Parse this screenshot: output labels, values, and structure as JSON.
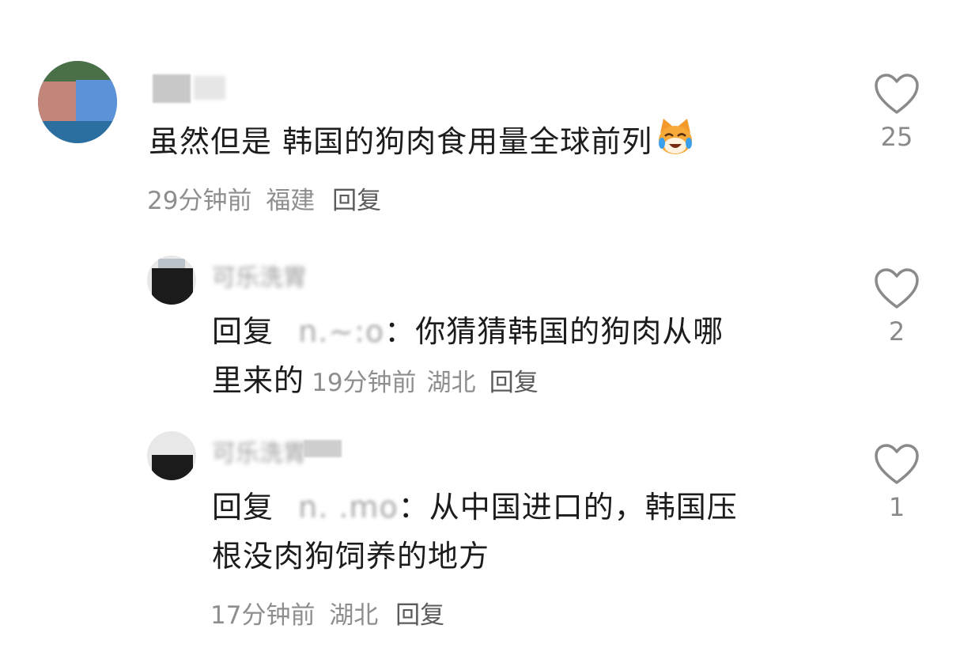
{
  "comments": [
    {
      "username": "██ ███",
      "text": "虽然但是 韩国的狗肉食用量全球前列",
      "emoji": "cat-laughing-crying-emoji",
      "time": "29分钟前",
      "location": "福建",
      "reply_label": "回复",
      "likes": "25"
    }
  ],
  "replies": [
    {
      "username": "可乐洗胃",
      "prefix": "回复",
      "mention": "n.~:o",
      "colon": "：",
      "text_line1": "你猜猜韩国的狗肉从哪",
      "text_line2": "里来的",
      "time": "19分钟前",
      "location": "湖北",
      "reply_label": "回复",
      "likes": "2"
    },
    {
      "username": "可乐洗胃",
      "prefix": "回复",
      "mention": "n. .mo",
      "colon": "：",
      "text_line1": "从中国进口的，韩国压",
      "text_line2": "根没肉狗饲养的地方",
      "time": "17分钟前",
      "location": "湖北",
      "reply_label": "回复",
      "likes": "1"
    }
  ],
  "icons": {
    "like": "heart-outline-icon"
  }
}
